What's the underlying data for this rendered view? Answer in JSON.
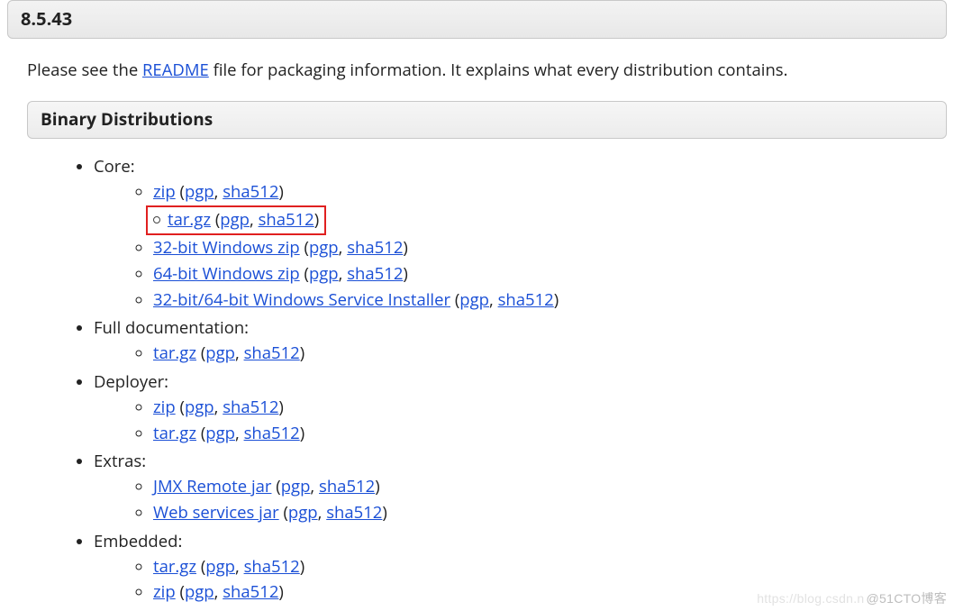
{
  "version": "8.5.43",
  "intro_prefix": "Please see the ",
  "intro_link": "README",
  "intro_suffix": " file for packaging information. It explains what every distribution contains.",
  "section_title": "Binary Distributions",
  "groups": [
    {
      "label": "Core:",
      "items": [
        {
          "main": "zip",
          "sigs": [
            "pgp",
            "sha512"
          ],
          "highlight": false
        },
        {
          "main": "tar.gz",
          "sigs": [
            "pgp",
            "sha512"
          ],
          "highlight": true
        },
        {
          "main": "32-bit Windows zip",
          "sigs": [
            "pgp",
            "sha512"
          ],
          "highlight": false
        },
        {
          "main": "64-bit Windows zip",
          "sigs": [
            "pgp",
            "sha512"
          ],
          "highlight": false
        },
        {
          "main": "32-bit/64-bit Windows Service Installer",
          "sigs": [
            "pgp",
            "sha512"
          ],
          "highlight": false
        }
      ]
    },
    {
      "label": "Full documentation:",
      "items": [
        {
          "main": "tar.gz",
          "sigs": [
            "pgp",
            "sha512"
          ],
          "highlight": false
        }
      ]
    },
    {
      "label": "Deployer:",
      "items": [
        {
          "main": "zip",
          "sigs": [
            "pgp",
            "sha512"
          ],
          "highlight": false
        },
        {
          "main": "tar.gz",
          "sigs": [
            "pgp",
            "sha512"
          ],
          "highlight": false
        }
      ]
    },
    {
      "label": "Extras:",
      "items": [
        {
          "main": "JMX Remote jar",
          "sigs": [
            "pgp",
            "sha512"
          ],
          "highlight": false
        },
        {
          "main": "Web services jar",
          "sigs": [
            "pgp",
            "sha512"
          ],
          "highlight": false
        }
      ]
    },
    {
      "label": "Embedded:",
      "items": [
        {
          "main": "tar.gz",
          "sigs": [
            "pgp",
            "sha512"
          ],
          "highlight": false
        },
        {
          "main": "zip",
          "sigs": [
            "pgp",
            "sha512"
          ],
          "highlight": false
        }
      ]
    }
  ],
  "watermark_faint": "https://blog.csdn.n",
  "watermark_text": "@51CTO博客"
}
